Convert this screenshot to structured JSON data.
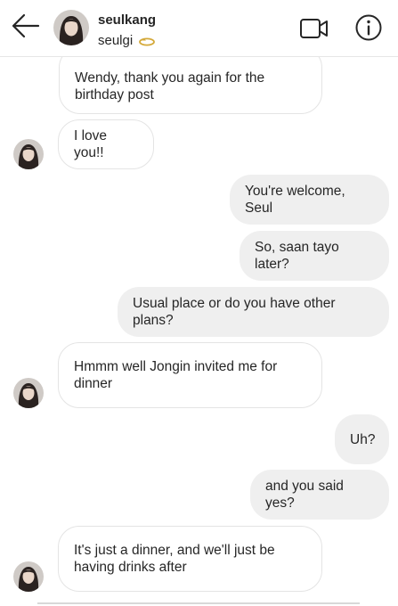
{
  "header": {
    "username": "seulkang",
    "subname": "seulgi"
  },
  "icons": {
    "back": "arrow-left-icon",
    "ring": "ring-icon",
    "video": "video-camera-icon",
    "info": "info-icon"
  },
  "colors": {
    "outgoing_bubble": "#efefef",
    "incoming_bubble_border": "#e4e4e4",
    "text": "#262626"
  },
  "messages": [
    {
      "from": "them",
      "line1": "Wendy, thank you again for the",
      "line2": "birthday post"
    },
    {
      "from": "them",
      "line1": "I love you!!"
    },
    {
      "from": "me",
      "line1": "You're welcome, Seul"
    },
    {
      "from": "me",
      "line1": "So, saan tayo later?"
    },
    {
      "from": "me",
      "line1": "Usual place or do you have other plans?"
    },
    {
      "from": "them",
      "line1": "Hmmm well Jongin invited me for",
      "line2": "dinner"
    },
    {
      "from": "me",
      "line1": "Uh?"
    },
    {
      "from": "me",
      "line1": "and you said yes?"
    },
    {
      "from": "them",
      "line1": "It's just a dinner, and we'll just be",
      "line2": "having drinks after"
    }
  ]
}
